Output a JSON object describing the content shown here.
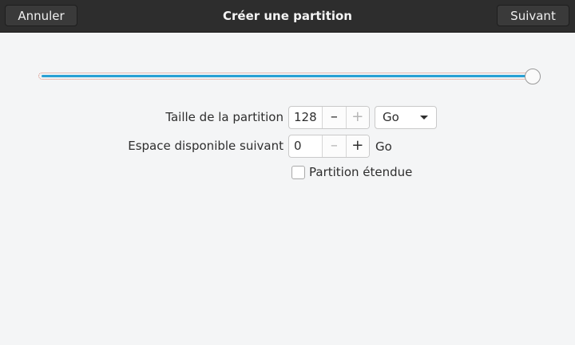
{
  "header": {
    "title": "Créer une partition",
    "cancel_label": "Annuler",
    "next_label": "Suivant"
  },
  "slider": {
    "level": 1.0
  },
  "partition_size": {
    "label": "Taille de la partition",
    "value": "128",
    "minus": "–",
    "plus": "+",
    "unit_selected": "Go"
  },
  "free_space_after": {
    "label": "Espace disponible suivant",
    "value": "0",
    "minus": "–",
    "plus": "+",
    "unit": "Go"
  },
  "extended": {
    "label": "Partition étendue",
    "checked": false
  },
  "colors": {
    "headerbar": "#2d2d2d",
    "accent": "#29a0d4",
    "background": "#f4f5f6"
  }
}
